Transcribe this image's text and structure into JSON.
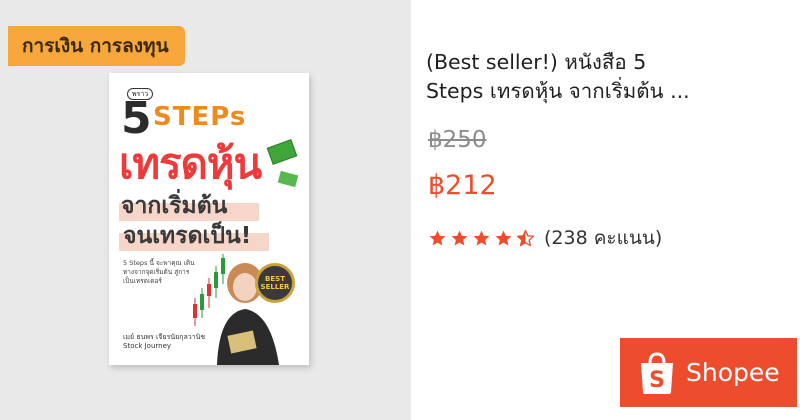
{
  "category_tag": "การเงิน การลงทุน",
  "book_cover": {
    "small_label": "พราว",
    "five": "5",
    "steps": "STEPs",
    "trade": "เทรดหุ้น",
    "line1": "จากเริ่มต้น",
    "line2": "จนเทรดเป็น!",
    "description": "5 Steps นี้ จะพาคุณ เดินทางจากจุดเริ่มต้น สู่การเป็นเทรดเดอร์",
    "badge_top": "BEST",
    "badge_bottom": "SELLER",
    "author": "เมย์ ธนพร เจียรนัยกุลวานิช",
    "author_sub": "Stock Journey"
  },
  "product": {
    "title_line1": "(Best seller!) หนังสือ 5",
    "title_line2": "Steps เทรดหุ้น จากเริ่มต้น ...",
    "original_price": "฿250",
    "sale_price": "฿212",
    "rating": 4.5,
    "rating_count": "(238 คะแนน)"
  },
  "shopee_button": {
    "label": "Shopee"
  },
  "colors": {
    "accent": "#ee4d2d",
    "star": "#ee4d2d",
    "tag": "#f7a73b"
  }
}
